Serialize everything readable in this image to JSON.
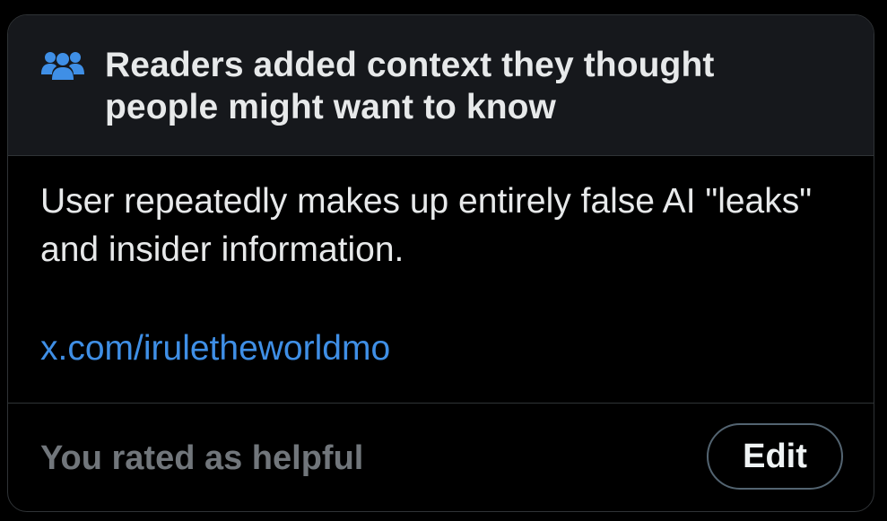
{
  "header": {
    "icon": "people-group-icon",
    "title": "Readers added context they thought people might want to know"
  },
  "note": {
    "text": "User repeatedly makes up entirely false AI \"leaks\" and insider information.",
    "link_text": "x.com/iruletheworldmo"
  },
  "footer": {
    "rating_text": "You rated as helpful",
    "edit_label": "Edit"
  },
  "colors": {
    "background": "#000000",
    "header_background": "#16181c",
    "border": "#2f3336",
    "primary_text": "#e7e9ea",
    "secondary_text": "#71767b",
    "link": "#3f8fe6",
    "icon": "#3f8fe6"
  }
}
